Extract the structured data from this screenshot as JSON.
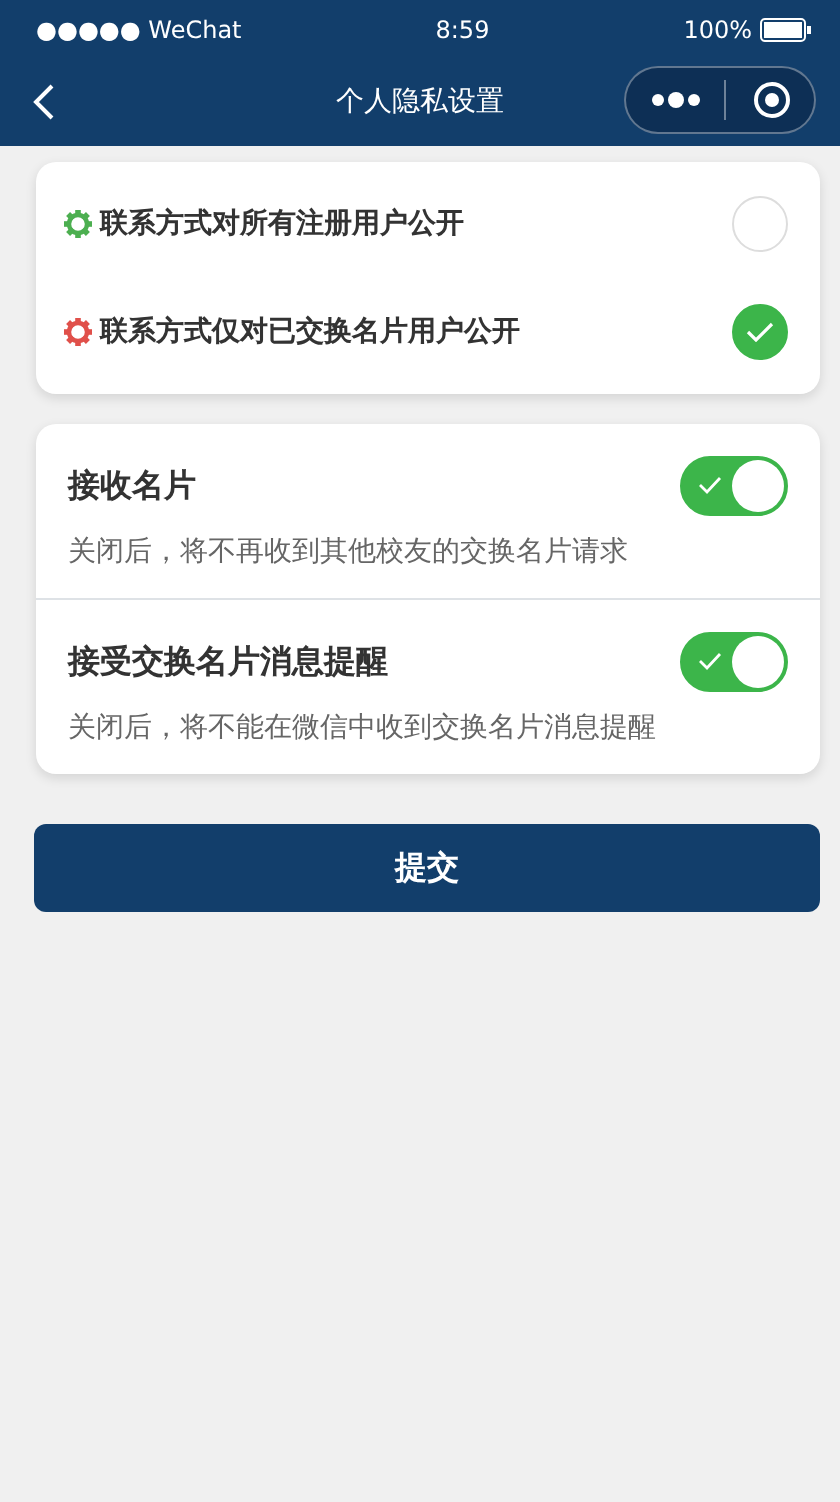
{
  "status_bar": {
    "carrier": "●●●●● WeChat",
    "time": "8:59",
    "battery": "100%"
  },
  "nav": {
    "title": "个人隐私设置"
  },
  "visibility_options": [
    {
      "label": "联系方式对所有注册用户公开",
      "color": "#4caf50",
      "selected": false
    },
    {
      "label": "联系方式仅对已交换名片用户公开",
      "color": "#e0504a",
      "selected": true
    }
  ],
  "toggles": [
    {
      "title": "接收名片",
      "on": true,
      "hint": "关闭后，将不再收到其他校友的交换名片请求"
    },
    {
      "title": "接受交换名片消息提醒",
      "on": true,
      "hint": "关闭后，将不能在微信中收到交换名片消息提醒"
    }
  ],
  "submit": "提交"
}
